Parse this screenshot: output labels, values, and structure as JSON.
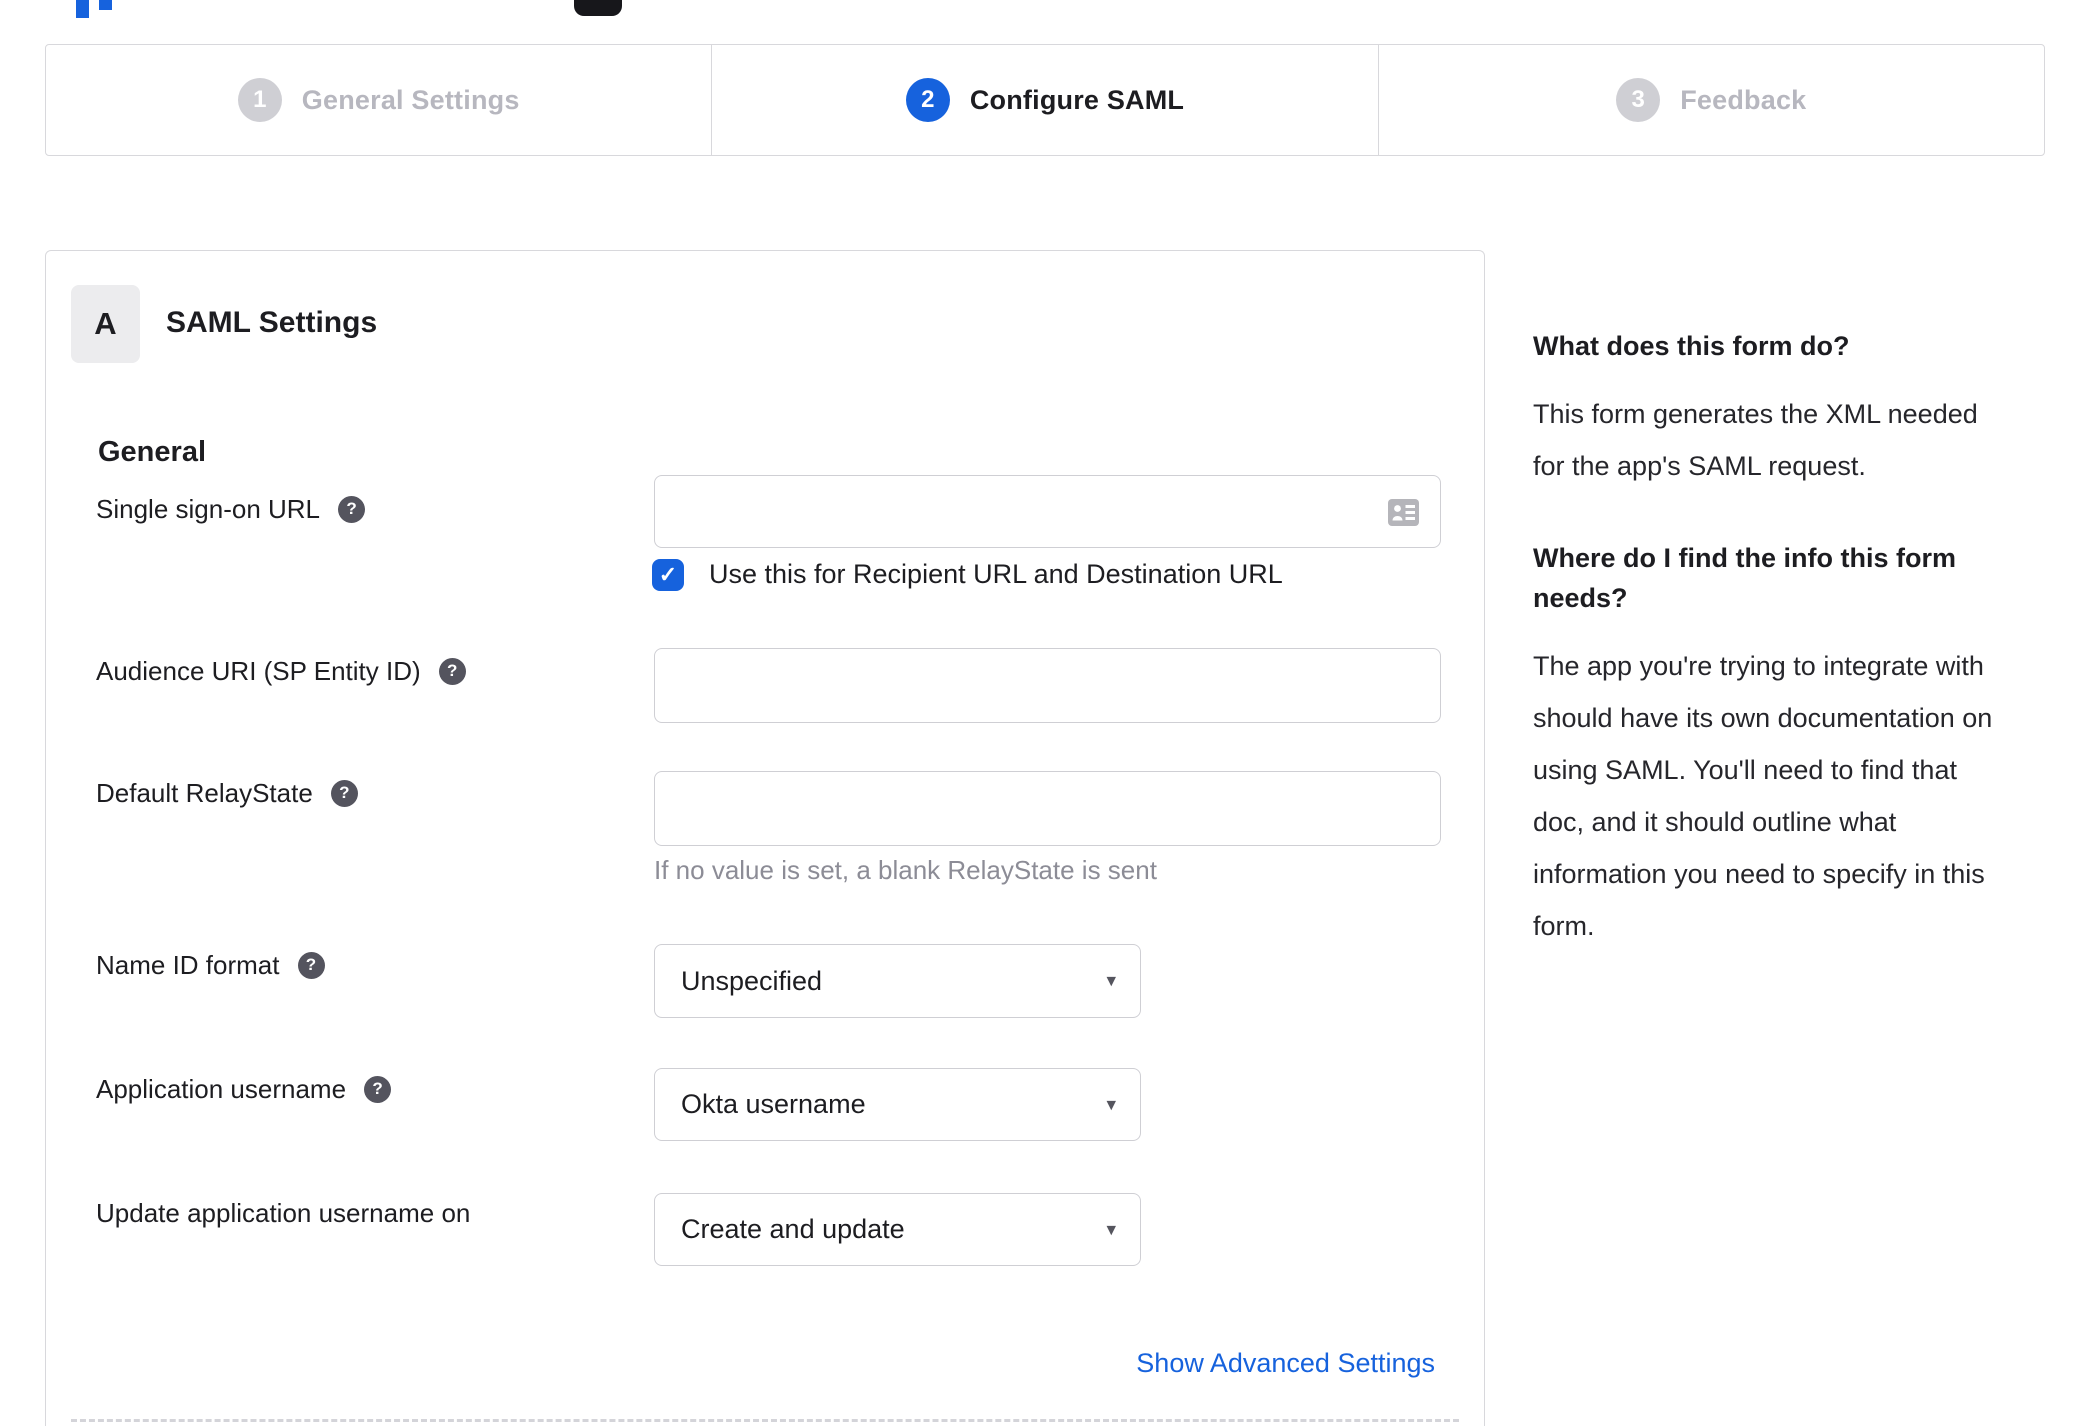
{
  "wizard": {
    "steps": [
      {
        "number": "1",
        "label": "General Settings",
        "state": "inactive"
      },
      {
        "number": "2",
        "label": "Configure SAML",
        "state": "active"
      },
      {
        "number": "3",
        "label": "Feedback",
        "state": "inactive"
      }
    ]
  },
  "panel": {
    "badge": "A",
    "title": "SAML Settings",
    "section_heading": "General",
    "form": {
      "sso": {
        "label": "Single sign-on URL",
        "value": "",
        "checkbox_checked": true,
        "checkbox_label": "Use this for Recipient URL and Destination URL"
      },
      "audience": {
        "label": "Audience URI (SP Entity ID)",
        "value": ""
      },
      "relay_state": {
        "label": "Default RelayState",
        "value": "",
        "hint": "If no value is set, a blank RelayState is sent"
      },
      "name_id_format": {
        "label": "Name ID format",
        "value": "Unspecified"
      },
      "app_username": {
        "label": "Application username",
        "value": "Okta username"
      },
      "update_app_username": {
        "label": "Update application username on",
        "value": "Create and update"
      }
    },
    "advanced_link": "Show Advanced Settings"
  },
  "sidebar": {
    "q1": "What does this form do?",
    "a1": "This form generates the XML needed\nfor the app's SAML request.",
    "q2": "Where do I find the info this form\nneeds?",
    "a2": "The app you're trying to integrate with\nshould have its own documentation on\nusing SAML. You'll need to find that\ndoc, and it should outline what\ninformation you need to specify in this\nform."
  },
  "icons": {
    "help_glyph": "?",
    "check_glyph": "✓",
    "caret_glyph": "▾"
  },
  "colors": {
    "accent": "#1662dd",
    "text": "#1d1d21",
    "muted_hint": "#8c8c96",
    "border": "#d8d8dc",
    "step_inactive_circle": "#cfcfd4",
    "step_inactive_label": "#b7b7bf",
    "badge_background": "#ececee",
    "help_icon_background": "#54545e"
  }
}
